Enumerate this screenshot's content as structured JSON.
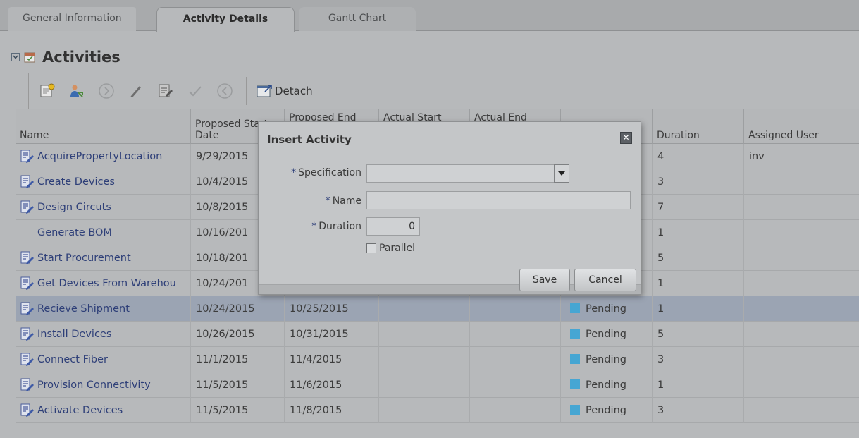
{
  "tabs": [
    {
      "label": "General Information"
    },
    {
      "label": "Activity Details"
    },
    {
      "label": "Gantt Chart"
    }
  ],
  "section": {
    "title": "Activities"
  },
  "toolbar": {
    "detach_label": "Detach"
  },
  "table": {
    "columns": {
      "name": "Name",
      "proposed_start": "Proposed Start\nDate",
      "proposed_end": "Proposed End",
      "actual_start": "Actual Start",
      "actual_end": "Actual End",
      "duration": "Duration",
      "assigned_user": "Assigned User"
    },
    "rows": [
      {
        "name": "AcquirePropertyLocation",
        "pstart": "9/29/2015",
        "pend": "",
        "astart": "",
        "aend": "",
        "status": "",
        "duration": "4",
        "user": "inv"
      },
      {
        "name": "Create Devices",
        "pstart": "10/4/2015",
        "pend": "",
        "astart": "",
        "aend": "",
        "status": "",
        "duration": "3",
        "user": ""
      },
      {
        "name": "Design Circuts",
        "pstart": "10/8/2015",
        "pend": "",
        "astart": "",
        "aend": "",
        "status": "",
        "duration": "7",
        "user": ""
      },
      {
        "name": "Generate BOM",
        "pstart": "10/16/201",
        "pend": "",
        "astart": "",
        "aend": "",
        "status": "",
        "duration": "1",
        "user": ""
      },
      {
        "name": "Start Procurement",
        "pstart": "10/18/201",
        "pend": "",
        "astart": "",
        "aend": "",
        "status": "",
        "duration": "5",
        "user": ""
      },
      {
        "name": "Get Devices From Warehou",
        "pstart": "10/24/201",
        "pend": "",
        "astart": "",
        "aend": "",
        "status": "",
        "duration": "1",
        "user": ""
      },
      {
        "name": "Recieve Shipment",
        "pstart": "10/24/2015",
        "pend": "10/25/2015",
        "astart": "",
        "aend": "",
        "status": "Pending",
        "duration": "1",
        "user": ""
      },
      {
        "name": "Install Devices",
        "pstart": "10/26/2015",
        "pend": "10/31/2015",
        "astart": "",
        "aend": "",
        "status": "Pending",
        "duration": "5",
        "user": ""
      },
      {
        "name": "Connect Fiber",
        "pstart": "11/1/2015",
        "pend": "11/4/2015",
        "astart": "",
        "aend": "",
        "status": "Pending",
        "duration": "3",
        "user": ""
      },
      {
        "name": "Provision Connectivity",
        "pstart": "11/5/2015",
        "pend": "11/6/2015",
        "astart": "",
        "aend": "",
        "status": "Pending",
        "duration": "1",
        "user": ""
      },
      {
        "name": "Activate Devices",
        "pstart": "11/5/2015",
        "pend": "11/8/2015",
        "astart": "",
        "aend": "",
        "status": "Pending",
        "duration": "3",
        "user": ""
      }
    ]
  },
  "dialog": {
    "title": "Insert Activity",
    "required_marker": "*",
    "specification_label": "Specification",
    "specification_value": "",
    "name_label": "Name",
    "name_value": "",
    "duration_label": "Duration",
    "duration_value": "0",
    "parallel_label": "Parallel",
    "save_label": "Save",
    "cancel_label": "Cancel",
    "close_glyph": "✕"
  },
  "colors": {
    "status_pending": "#46a6d3",
    "selected_row": "#9ba4b3"
  }
}
